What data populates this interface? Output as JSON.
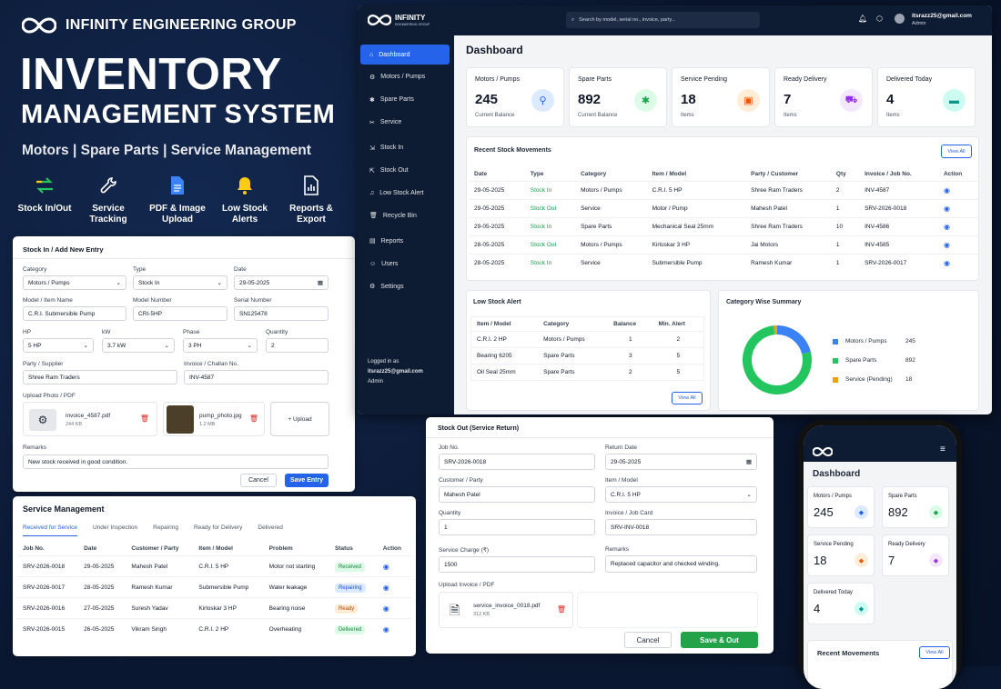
{
  "hero": {
    "brand": "INFINITY ENGINEERING GROUP",
    "title_line1": "INVENTORY",
    "title_line2": "MANAGEMENT SYSTEM",
    "subtitle": "Motors | Spare Parts | Service Management",
    "features": [
      {
        "icon": "swap-arrows-icon",
        "label": "Stock In/Out"
      },
      {
        "icon": "wrench-icon",
        "label": "Service Tracking"
      },
      {
        "icon": "document-icon",
        "label": "PDF & Image Upload"
      },
      {
        "icon": "bell-icon",
        "label": "Low Stock Alerts"
      },
      {
        "icon": "report-icon",
        "label": "Reports & Export"
      }
    ]
  },
  "dashboard": {
    "logo_name": "INFINITY",
    "logo_sub": "ENGINEERING GROUP",
    "search_placeholder": "Search by model, serial no., invoice, party...",
    "user_email": "itsrazz25@gmail.com",
    "user_role": "Admin",
    "page_title": "Dashboard",
    "sidebar": [
      {
        "label": "Dashboard",
        "icon": "home-icon"
      },
      {
        "label": "Motors / Pumps",
        "icon": "motor-icon"
      },
      {
        "label": "Spare Parts",
        "icon": "parts-icon"
      },
      {
        "label": "Service",
        "icon": "tools-icon"
      },
      {
        "label": "Stock In",
        "icon": "stock-in-icon"
      },
      {
        "label": "Stock Out",
        "icon": "stock-out-icon"
      },
      {
        "label": "Low Stock Alert",
        "icon": "bell-icon"
      },
      {
        "label": "Recycle Bin",
        "icon": "trash-icon"
      },
      {
        "label": "Reports",
        "icon": "report-icon"
      },
      {
        "label": "Users",
        "icon": "users-icon"
      },
      {
        "label": "Settings",
        "icon": "gear-icon"
      }
    ],
    "logged_in_label": "Logged in as",
    "logged_in_email": "itsrazz25@gmail.com",
    "logged_in_role": "Admin",
    "stats": [
      {
        "title": "Motors / Pumps",
        "value": "245",
        "sub": "Current Balance",
        "color": "#dbeafe",
        "fg": "#2563eb",
        "icon": "motor-icon"
      },
      {
        "title": "Spare Parts",
        "value": "892",
        "sub": "Current Balance",
        "color": "#dcfce7",
        "fg": "#16a34a",
        "icon": "parts-icon"
      },
      {
        "title": "Service Pending",
        "value": "18",
        "sub": "Items",
        "color": "#ffedd5",
        "fg": "#ea580c",
        "icon": "clipboard-icon"
      },
      {
        "title": "Ready Delivery",
        "value": "7",
        "sub": "Items",
        "color": "#f3e8ff",
        "fg": "#9333ea",
        "icon": "truck-icon"
      },
      {
        "title": "Delivered Today",
        "value": "4",
        "sub": "Items",
        "color": "#ccfbf1",
        "fg": "#0d9488",
        "icon": "box-icon"
      }
    ],
    "movements": {
      "title": "Recent Stock Movements",
      "view_all": "View All",
      "columns": [
        "Date",
        "Type",
        "Category",
        "Item / Model",
        "Party / Customer",
        "Qty",
        "Invoice / Job No.",
        "Action"
      ],
      "rows": [
        [
          "29-05-2025",
          "Stock In",
          "Motors / Pumps",
          "C.R.I. 5 HP",
          "Shree Ram Traders",
          "2",
          "INV-4587"
        ],
        [
          "29-05-2025",
          "Stock Out",
          "Service",
          "Motor / Pump",
          "Mahesh Patel",
          "1",
          "SRV-2026-0018"
        ],
        [
          "29-05-2025",
          "Stock In",
          "Spare Parts",
          "Mechanical Seal 25mm",
          "Shree Ram Traders",
          "10",
          "INV-4586"
        ],
        [
          "28-05-2025",
          "Stock Out",
          "Motors / Pumps",
          "Kirloskar 3 HP",
          "Jai Motors",
          "1",
          "INV-4585"
        ],
        [
          "28-05-2025",
          "Stock In",
          "Service",
          "Submersible Pump",
          "Ramesh Kumar",
          "1",
          "SRV-2026-0017"
        ]
      ]
    },
    "low_stock": {
      "title": "Low Stock Alert",
      "view_all": "View All",
      "columns": [
        "Item / Model",
        "Category",
        "Balance",
        "Min. Alert"
      ],
      "rows": [
        [
          "C.R.I. 2 HP",
          "Motors / Pumps",
          "1",
          "2"
        ],
        [
          "Bearing 6205",
          "Spare Parts",
          "3",
          "5"
        ],
        [
          "Oil Seal 25mm",
          "Spare Parts",
          "2",
          "5"
        ]
      ]
    },
    "summary": {
      "title": "Category Wise Summary",
      "chart_data": {
        "type": "pie",
        "labels": [
          "Motors / Pumps",
          "Spare Parts",
          "Service (Pending)"
        ],
        "values": [
          245,
          892,
          18
        ],
        "colors": [
          "#3b82f6",
          "#22c55e",
          "#f59e0b"
        ]
      }
    }
  },
  "stock_in": {
    "title": "Stock In / Add New Entry",
    "fields": {
      "category": {
        "label": "Category",
        "value": "Motors / Pumps"
      },
      "type": {
        "label": "Type",
        "value": "Stock In"
      },
      "date": {
        "label": "Date",
        "value": "29-05-2025"
      },
      "model": {
        "label": "Model / Item Name",
        "value": "C.R.I. Submersible Pump"
      },
      "model_number": {
        "label": "Model Number",
        "value": "CRI-5HP"
      },
      "serial": {
        "label": "Serial Number",
        "value": "SN125478"
      },
      "hp": {
        "label": "HP",
        "value": "5 HP"
      },
      "kw": {
        "label": "kW",
        "value": "3.7 kW"
      },
      "phase": {
        "label": "Phase",
        "value": "3 PH"
      },
      "quantity": {
        "label": "Quantity",
        "value": "2"
      },
      "party": {
        "label": "Party / Supplier",
        "value": "Shree Ram Traders"
      },
      "invoice": {
        "label": "Invoice / Challan No.",
        "value": "INV-4587"
      },
      "remarks": {
        "label": "Remarks",
        "value": "New stock received in good condition."
      }
    },
    "upload_label": "Upload Photo / PDF",
    "files": [
      {
        "name": "invoice_4587.pdf",
        "size": "244 KB"
      },
      {
        "name": "pump_photo.jpg",
        "size": "1.2 MB"
      }
    ],
    "upload_button": "+ Upload",
    "cancel": "Cancel",
    "save": "Save Entry"
  },
  "service": {
    "title": "Service Management",
    "tabs": [
      "Received for Service",
      "Under Inspection",
      "Repairing",
      "Ready for Delivery",
      "Delivered"
    ],
    "columns": [
      "Job No.",
      "Date",
      "Customer / Party",
      "Item / Model",
      "Problem",
      "Status",
      "Action"
    ],
    "rows": [
      [
        "SRV-2026-0018",
        "29-05-2025",
        "Mahesh Patel",
        "C.R.I. 5 HP",
        "Motor not starting",
        "Received"
      ],
      [
        "SRV-2026-0017",
        "28-05-2025",
        "Ramesh Kumar",
        "Submersible Pump",
        "Water leakage",
        "Repairing"
      ],
      [
        "SRV-2026-0016",
        "27-05-2025",
        "Suresh Yadav",
        "Kirloskar 3 HP",
        "Bearing noise",
        "Ready"
      ],
      [
        "SRV-2026-0015",
        "26-05-2025",
        "Vikram Singh",
        "C.R.I. 2 HP",
        "Overheating",
        "Delivered"
      ]
    ],
    "status_colors": {
      "Received": [
        "#dcfce7",
        "#15803d"
      ],
      "Repairing": [
        "#dbeafe",
        "#1d4ed8"
      ],
      "Ready": [
        "#ffedd5",
        "#c2410c"
      ],
      "Delivered": [
        "#dcfce7",
        "#15803d"
      ]
    }
  },
  "stock_out": {
    "title": "Stock Out (Service Return)",
    "fields": {
      "job": {
        "label": "Job No.",
        "value": "SRV-2026-0018"
      },
      "return_date": {
        "label": "Return Date",
        "value": "29-05-2025"
      },
      "customer": {
        "label": "Customer / Party",
        "value": "Mahesh Patel"
      },
      "item": {
        "label": "Item / Model",
        "value": "C.R.I. 5 HP"
      },
      "quantity": {
        "label": "Quantity",
        "value": "1"
      },
      "job_card": {
        "label": "Invoice / Job Card",
        "value": "SRV-INV-0018"
      },
      "charge": {
        "label": "Service Charge (₹)",
        "value": "1500"
      },
      "remarks": {
        "label": "Remarks",
        "value": "Replaced capacitor and checked winding."
      }
    },
    "upload_label": "Upload Invoice / PDF",
    "file": {
      "name": "service_invoice_0018.pdf",
      "size": "312 KB"
    },
    "cancel": "Cancel",
    "save": "Save & Out"
  },
  "mobile": {
    "title": "Dashboard",
    "stats": [
      {
        "title": "Motors / Pumps",
        "value": "245",
        "color": "#dbeafe",
        "fg": "#2563eb"
      },
      {
        "title": "Spare Parts",
        "value": "892",
        "color": "#dcfce7",
        "fg": "#16a34a"
      },
      {
        "title": "Service Pending",
        "value": "18",
        "color": "#ffedd5",
        "fg": "#ea580c"
      },
      {
        "title": "Ready Delivery",
        "value": "7",
        "color": "#f3e8ff",
        "fg": "#9333ea"
      },
      {
        "title": "Delivered Today",
        "value": "4",
        "color": "#ccfbf1",
        "fg": "#0d9488"
      }
    ],
    "recent_title": "Recent Movements",
    "view_all": "View All"
  }
}
